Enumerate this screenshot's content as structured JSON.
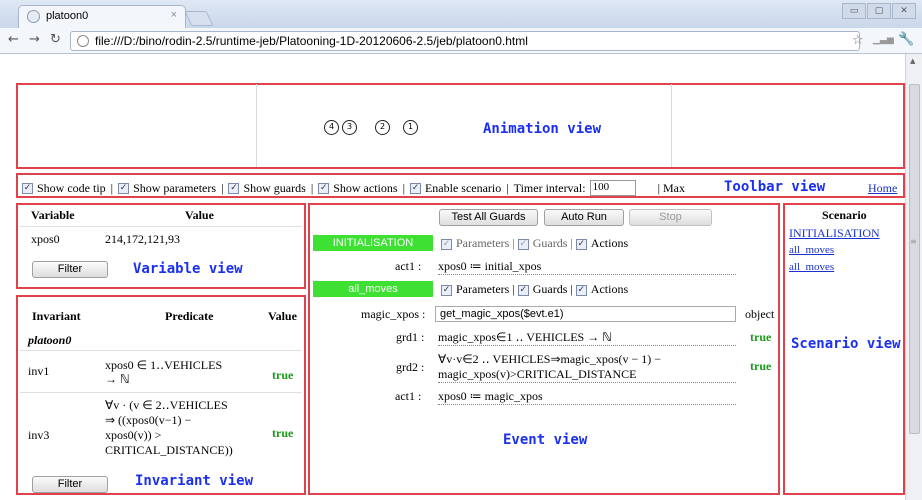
{
  "browser": {
    "tab_title": "platoon0",
    "tab_close": "×",
    "url": "file:///D:/bino/rodin-2.5/runtime-jeb/Platooning-1D-20120606-2.5/jeb/platoon0.html",
    "window_buttons": [
      "▭",
      "▢",
      "✕"
    ]
  },
  "annotations": {
    "animation_view": "Animation view",
    "toolbar_view": "Toolbar view",
    "variable_view": "Variable view",
    "invariant_view": "Invariant view",
    "event_view": "Event view",
    "scenario_view": "Scenario view"
  },
  "animation": {
    "icons": [
      "4",
      "3",
      "2",
      "1"
    ]
  },
  "toolbar": {
    "show_code_tip": "Show code tip",
    "show_parameters": "Show parameters",
    "show_guards": "Show guards",
    "show_actions": "Show actions",
    "enable_scenario": "Enable scenario",
    "timer_label": "Timer interval:",
    "timer_value": "100",
    "max_label": "Max",
    "home_link": "Home",
    "sep": "|"
  },
  "variables": {
    "col_variable": "Variable",
    "col_value": "Value",
    "rows": [
      {
        "name": "xpos0",
        "value": "214,172,121,93"
      }
    ],
    "filter_label": "Filter"
  },
  "invariants": {
    "col_invariant": "Invariant",
    "col_predicate": "Predicate",
    "col_value": "Value",
    "group": "platoon0",
    "rows": [
      {
        "name": "inv1",
        "predicate_lines": [
          "xpos0 ∈ 1‥VEHICLES",
          "→ ℕ"
        ],
        "value": "true"
      },
      {
        "name": "inv3",
        "predicate_lines": [
          "∀v · (v ∈ 2‥VEHICLES",
          "⇒ ((xpos0(v−1) −",
          "xpos0(v)) >",
          "CRITICAL_DISTANCE))"
        ],
        "value": "true"
      }
    ],
    "filter_label": "Filter"
  },
  "events": {
    "test_all_guards": "Test All Guards",
    "auto_run": "Auto Run",
    "stop": "Stop",
    "initialisation": {
      "name": "INITIALISATION",
      "parameters": "Parameters",
      "guards": "Guards",
      "actions": "Actions",
      "act_label": "act1 :",
      "act_text": "xpos0 ≔ initial_xpos"
    },
    "all_moves": {
      "name": "all_moves",
      "parameters": "Parameters",
      "guards": "Guards",
      "actions": "Actions",
      "param_label": "magic_xpos :",
      "param_value": "get_magic_xpos($evt.e1)",
      "param_type": "object",
      "grd1_label": "grd1 :",
      "grd1_text": "magic_xpos∈1 ‥ VEHICLES → ℕ",
      "grd1_value": "true",
      "grd2_label": "grd2 :",
      "grd2_text_line1": "∀v·v∈2 ‥ VEHICLES⇒magic_xpos(v − 1) −",
      "grd2_text_line2": "magic_xpos(v)>CRITICAL_DISTANCE",
      "grd2_value": "true",
      "act_label": "act1 :",
      "act_text": "xpos0 ≔ magic_xpos"
    }
  },
  "scenario": {
    "title": "Scenario",
    "items": [
      "INITIALISATION",
      "all_moves",
      "all_moves"
    ]
  },
  "colors": {
    "annotation_red": "#e0424d",
    "annotation_blue": "#1a2ff0",
    "event_green": "#3ee034",
    "true_green": "#1a9a1a"
  }
}
